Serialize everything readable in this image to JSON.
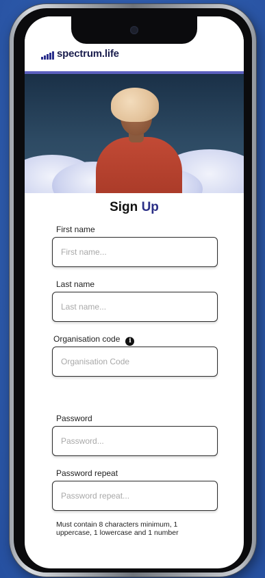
{
  "app": {
    "brand": "spectrum.life",
    "accent_color": "#5b5fbf",
    "brand_color": "#2a2f8c"
  },
  "form": {
    "title_main": "Sign ",
    "title_accent": "Up",
    "fields": [
      {
        "label": "First name",
        "placeholder": "First name...",
        "value": ""
      },
      {
        "label": "Last name",
        "placeholder": "Last name...",
        "value": ""
      },
      {
        "label": "Organisation code",
        "placeholder": "Organisation Code",
        "value": "",
        "icon": "info-icon"
      },
      {
        "label": "Password",
        "placeholder": "Password...",
        "value": ""
      },
      {
        "label": "Password repeat",
        "placeholder": "Password repeat...",
        "value": ""
      }
    ],
    "password_hint": "Must contain 8 characters minimum, 1 uppercase, 1 lowercase and 1 number"
  }
}
